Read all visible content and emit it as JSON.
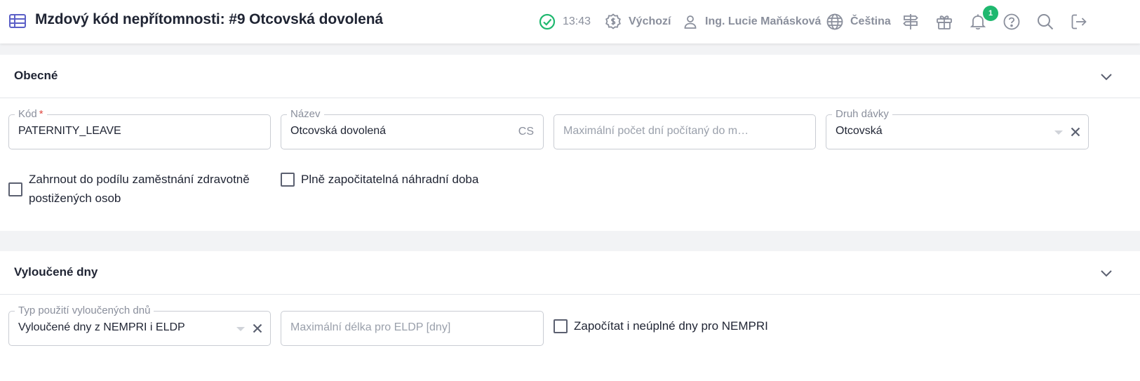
{
  "header": {
    "title": "Mzdový kód nepřítomnosti: #9 Otcovská dovolená",
    "time": "13:43",
    "currency_profile": "Výchozí",
    "user_name": "Ing. Lucie Maňásková",
    "language": "Čeština",
    "notification_count": "1",
    "icons": [
      "table-icon",
      "check-circle-icon",
      "money-icon",
      "user-icon",
      "globe-icon",
      "signpost-icon",
      "gift-icon",
      "bell-icon",
      "help-icon",
      "search-icon",
      "logout-icon"
    ],
    "accent_color": "#5b5fc7",
    "success_color": "#1fb86f"
  },
  "sections": {
    "general": {
      "title": "Obecné",
      "code": {
        "label": "Kód",
        "required_mark": "*",
        "value": "PATERNITY_LEAVE"
      },
      "name": {
        "label": "Název",
        "value": "Otcovská dovolená",
        "suffix": "CS"
      },
      "max_days": {
        "placeholder": "Maximální počet dní počítaný do m…"
      },
      "benefit_type": {
        "label": "Druh dávky",
        "value": "Otcovská"
      },
      "checkbox_disabled_share": {
        "label": "Zahrnout do podílu zaměstnání zdravotně postižených osob",
        "checked": false
      },
      "checkbox_substitute_time": {
        "label": "Plně započitatelná náhradní doba",
        "checked": false
      }
    },
    "excluded_days": {
      "title": "Vyloučené dny",
      "usage_type": {
        "label": "Typ použití vyloučených dnů",
        "value": "Vyloučené dny z NEMPRI i ELDP"
      },
      "max_eldp": {
        "placeholder": "Maximální délka pro ELDP [dny]"
      },
      "checkbox_incomplete_days": {
        "label": "Započítat i neúplné dny pro NEMPRI",
        "checked": false
      }
    }
  }
}
